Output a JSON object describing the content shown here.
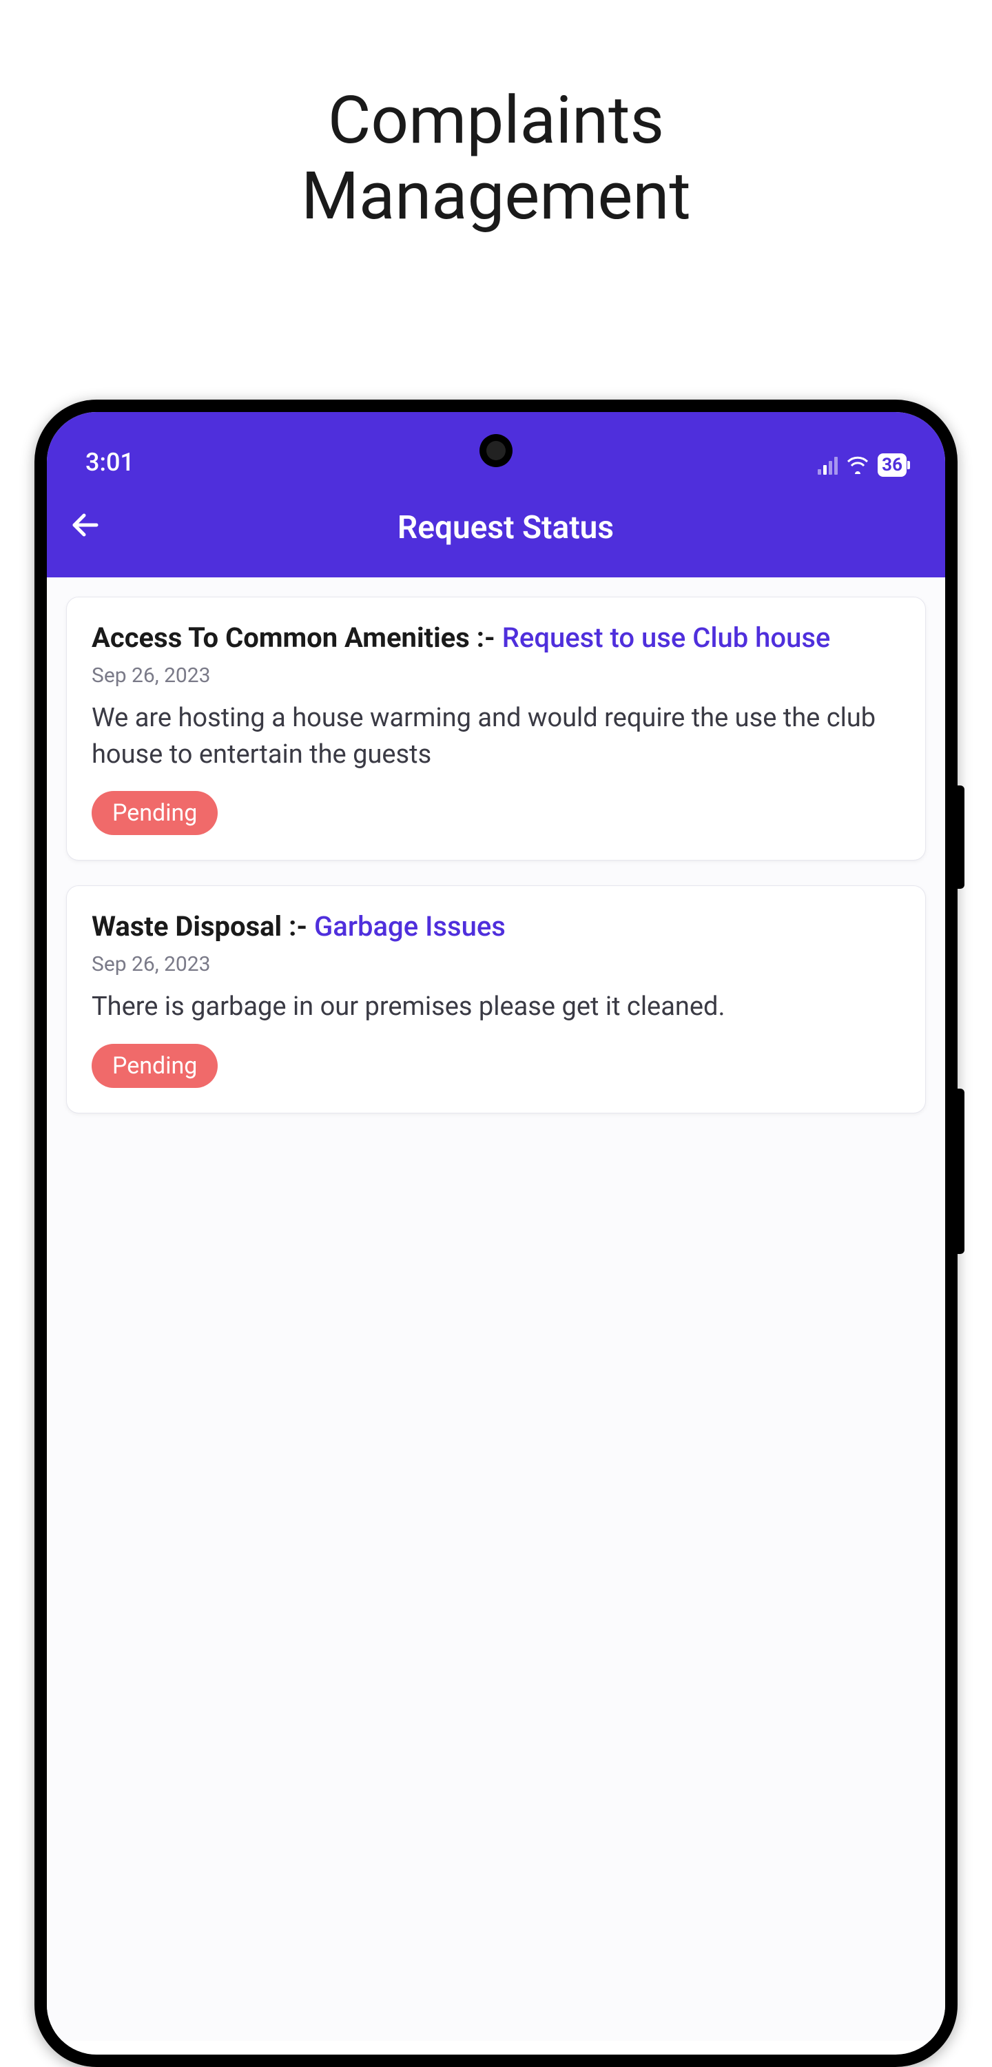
{
  "heading_l1": "Complaints",
  "heading_l2": "Management",
  "status": {
    "time": "3:01",
    "battery": "36"
  },
  "app": {
    "title": "Request Status"
  },
  "cards": [
    {
      "category": "Access To Common Amenities :- ",
      "subject": "Request to use Club house",
      "date": "Sep 26, 2023",
      "desc": "We are hosting a house warming and would require the use the club house to entertain the guests",
      "status": "Pending"
    },
    {
      "category": "Waste Disposal :- ",
      "subject": "Garbage Issues",
      "date": "Sep 26, 2023",
      "desc": "There is garbage in our premises please get it cleaned.",
      "status": "Pending"
    }
  ]
}
